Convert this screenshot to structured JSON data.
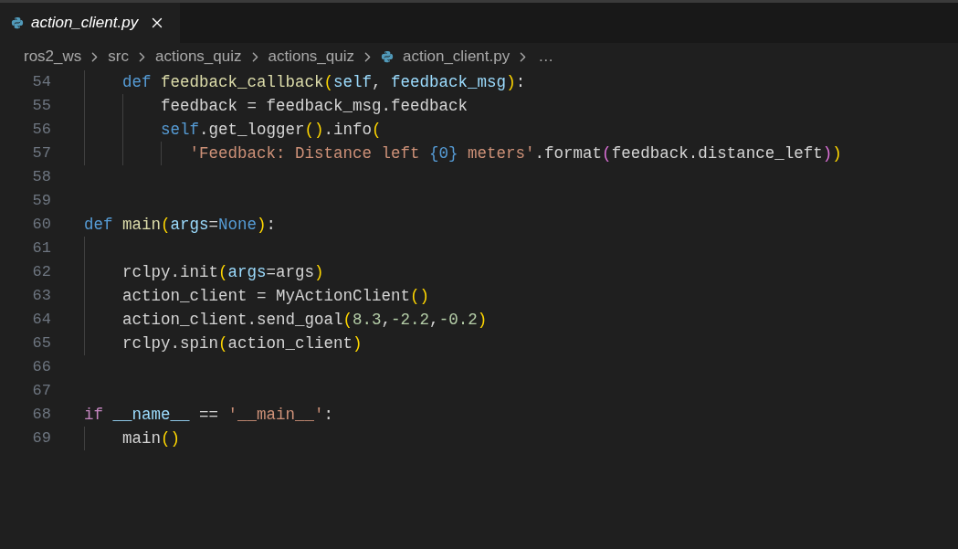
{
  "tab": {
    "title": "action_client.py",
    "preview": true
  },
  "breadcrumb": {
    "segments": [
      {
        "kind": "folder",
        "label": "ros2_ws"
      },
      {
        "kind": "folder",
        "label": "src"
      },
      {
        "kind": "folder",
        "label": "actions_quiz"
      },
      {
        "kind": "folder",
        "label": "actions_quiz"
      },
      {
        "kind": "file",
        "label": "action_client.py"
      }
    ],
    "more": "…"
  },
  "code": [
    {
      "number": "54",
      "tokens": [
        {
          "kind": "keyword",
          "text": "    def"
        },
        {
          "kind": "function",
          "text": " feedback_callback"
        },
        {
          "kind": "bracket1",
          "text": "("
        },
        {
          "kind": "param",
          "text": "self"
        },
        {
          "kind": "plain",
          "text": ", "
        },
        {
          "kind": "param",
          "text": "feedback_msg"
        },
        {
          "kind": "bracket1",
          "text": ")"
        },
        {
          "kind": "plain",
          "text": ":"
        }
      ]
    },
    {
      "number": "55",
      "tokens": [
        {
          "kind": "plain",
          "text": "        feedback = feedback_msg.feedback"
        }
      ]
    },
    {
      "number": "56",
      "tokens": [
        {
          "kind": "keyword",
          "text": "        self"
        },
        {
          "kind": "plain",
          "text": ".get_logger"
        },
        {
          "kind": "bracket1",
          "text": "()"
        },
        {
          "kind": "plain",
          "text": ".info"
        },
        {
          "kind": "bracket1",
          "text": "("
        }
      ]
    },
    {
      "number": "57",
      "tokens": [
        {
          "kind": "string",
          "text": "           'Feedback: Distance left "
        },
        {
          "kind": "keyword",
          "text": "{0}"
        },
        {
          "kind": "string",
          "text": " meters'"
        },
        {
          "kind": "plain",
          "text": ".format"
        },
        {
          "kind": "bracket2",
          "text": "("
        },
        {
          "kind": "plain",
          "text": "feedback.distance_left"
        },
        {
          "kind": "bracket2",
          "text": ")"
        },
        {
          "kind": "bracket1",
          "text": ")"
        }
      ]
    },
    {
      "number": "58"
    },
    {
      "number": "59"
    },
    {
      "number": "60",
      "tokens": [
        {
          "kind": "keyword",
          "text": "def"
        },
        {
          "kind": "function",
          "text": " main"
        },
        {
          "kind": "bracket1",
          "text": "("
        },
        {
          "kind": "param",
          "text": "args"
        },
        {
          "kind": "plain",
          "text": "="
        },
        {
          "kind": "keyword",
          "text": "None"
        },
        {
          "kind": "bracket1",
          "text": ")"
        },
        {
          "kind": "plain",
          "text": ":"
        }
      ]
    },
    {
      "number": "61"
    },
    {
      "number": "62",
      "tokens": [
        {
          "kind": "plain",
          "text": "    rclpy.init"
        },
        {
          "kind": "bracket1",
          "text": "("
        },
        {
          "kind": "param",
          "text": "args"
        },
        {
          "kind": "plain",
          "text": "=args"
        },
        {
          "kind": "bracket1",
          "text": ")"
        }
      ]
    },
    {
      "number": "63",
      "tokens": [
        {
          "kind": "plain",
          "text": "    action_client = MyActionClient"
        },
        {
          "kind": "bracket1",
          "text": "()"
        }
      ]
    },
    {
      "number": "64",
      "tokens": [
        {
          "kind": "plain",
          "text": "    action_client.send_goal"
        },
        {
          "kind": "bracket1",
          "text": "("
        },
        {
          "kind": "number",
          "text": "8.3"
        },
        {
          "kind": "plain",
          "text": ","
        },
        {
          "kind": "number",
          "text": "-2.2"
        },
        {
          "kind": "plain",
          "text": ","
        },
        {
          "kind": "number",
          "text": "-0.2"
        },
        {
          "kind": "bracket1",
          "text": ")"
        }
      ]
    },
    {
      "number": "65",
      "tokens": [
        {
          "kind": "plain",
          "text": "    rclpy.spin"
        },
        {
          "kind": "bracket1",
          "text": "("
        },
        {
          "kind": "plain",
          "text": "action_client"
        },
        {
          "kind": "bracket1",
          "text": ")"
        }
      ]
    },
    {
      "number": "66"
    },
    {
      "number": "67"
    },
    {
      "number": "68",
      "tokens": [
        {
          "kind": "control",
          "text": "if"
        },
        {
          "kind": "param",
          "text": " __name__"
        },
        {
          "kind": "plain",
          "text": " == "
        },
        {
          "kind": "string",
          "text": "'__main__'"
        },
        {
          "kind": "plain",
          "text": ":"
        }
      ]
    },
    {
      "number": "69",
      "tokens": [
        {
          "kind": "plain",
          "text": "    main"
        },
        {
          "kind": "bracket1",
          "text": "()"
        }
      ]
    }
  ]
}
